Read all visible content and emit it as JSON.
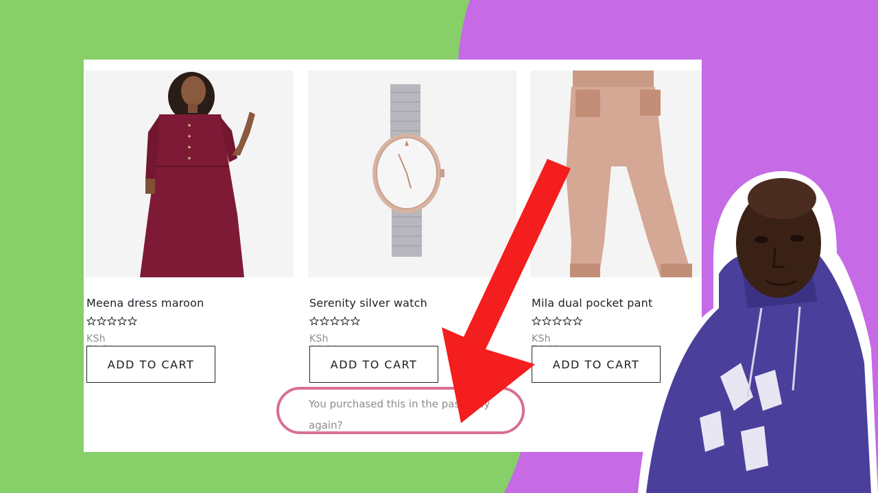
{
  "background": {
    "left_color": "#86cf69",
    "right_color": "#c66ae6"
  },
  "products": [
    {
      "title": "Meena dress maroon",
      "price": "KSh 72.50",
      "button": "ADD TO CART",
      "image": "maroon-dress-photo"
    },
    {
      "title": "Serenity silver watch",
      "price": "KSh 84.99",
      "button": "ADD TO CART",
      "image": "silver-watch-photo"
    },
    {
      "title": "Mila dual pocket pant",
      "price": "KSh 74.99",
      "button": "ADD TO CART",
      "image": "pink-pants-photo"
    }
  ],
  "notice": {
    "text": "You purchased this in the past. Buy again?"
  },
  "colors": {
    "arrow": "#f41e1e",
    "highlight": "#d76e96",
    "hoodie": "#4a3f9b"
  }
}
